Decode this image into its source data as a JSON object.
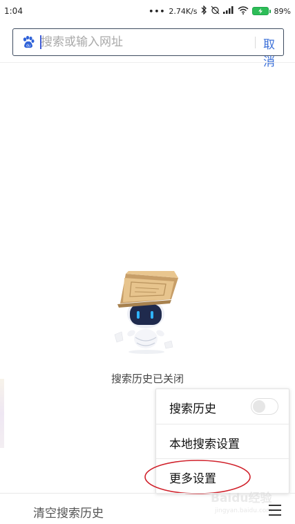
{
  "status_bar": {
    "time": "1:04",
    "network_speed": "2.74K/s",
    "battery_percent": "89%",
    "battery_level": 0.89,
    "icons": [
      "more-dots-icon",
      "bluetooth-icon",
      "alarm-off-icon",
      "signal-icon",
      "wifi-icon",
      "battery-charging-icon"
    ]
  },
  "search": {
    "placeholder": "搜索或输入网址",
    "value": "",
    "cancel_label": "取消",
    "engine_icon": "baidu-paw-icon"
  },
  "empty_state": {
    "message": "搜索历史已关闭",
    "illustration": "robot-with-box-mascot"
  },
  "menu": {
    "items": [
      {
        "label": "搜索历史",
        "toggle_on": false
      },
      {
        "label": "本地搜索设置"
      },
      {
        "label": "更多设置"
      }
    ],
    "highlight_color": "#d0202a"
  },
  "bottom_bar": {
    "clear_label": "清空搜索历史",
    "menu_icon": "hamburger-menu-icon"
  },
  "watermark": {
    "text": "Baidu经验",
    "url": "jingyan.baidu.com"
  },
  "colors": {
    "accent": "#3a6fd8",
    "search_border": "#3c4a5e",
    "battery": "#2dbd57"
  }
}
